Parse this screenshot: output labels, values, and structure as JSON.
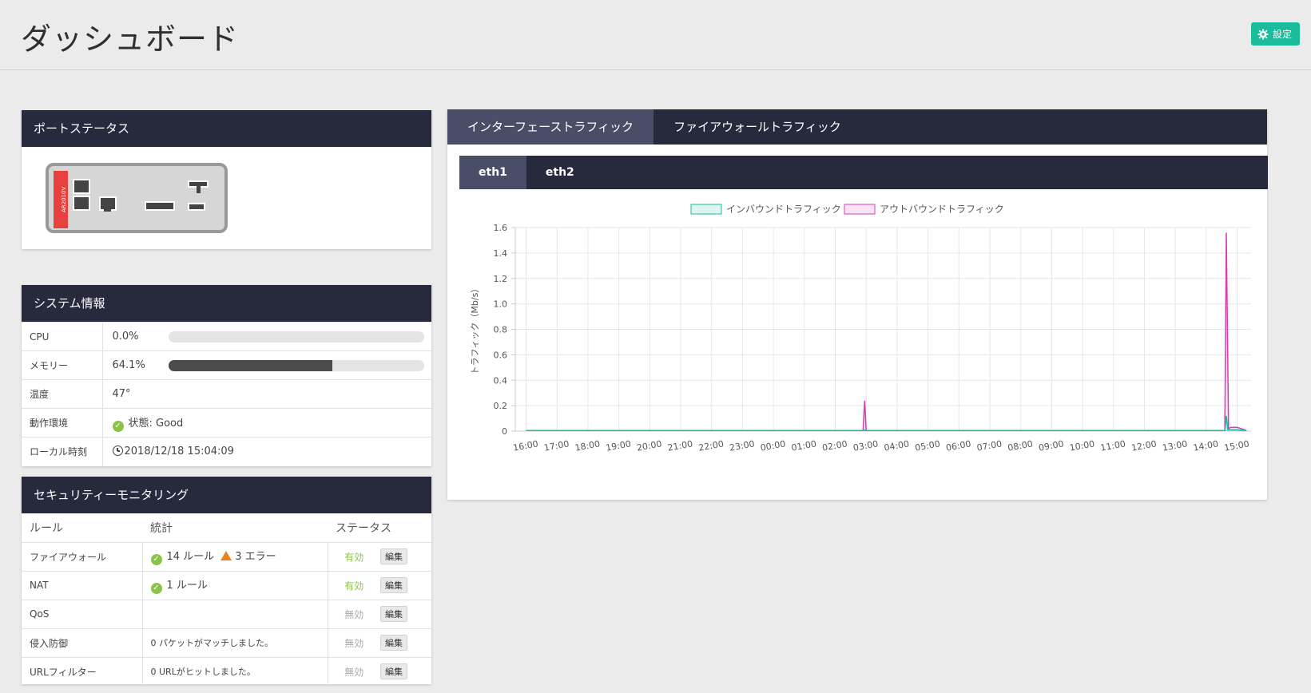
{
  "header": {
    "title": "ダッシュボード",
    "settings_label": "設定"
  },
  "port_status": {
    "title": "ポートステータス",
    "model": "AR2010V"
  },
  "system_info": {
    "title": "システム情報",
    "rows": [
      {
        "label": "CPU",
        "value": "0.0%",
        "fraction": 0.0
      },
      {
        "label": "メモリー",
        "value": "64.1%",
        "fraction": 0.641
      },
      {
        "label": "温度",
        "value": "47°"
      },
      {
        "label": "動作環境",
        "value": "状態: Good"
      },
      {
        "label": "ローカル時刻",
        "value": "2018/12/18 15:04:09"
      }
    ]
  },
  "security": {
    "title": "セキュリティーモニタリング",
    "columns": [
      "ルール",
      "統計",
      "ステータス"
    ],
    "edit_label": "編集",
    "rows": [
      {
        "rule": "ファイアウォール",
        "stat": "14 ルール",
        "errors": "3 エラー",
        "status": "有効"
      },
      {
        "rule": "NAT",
        "stat": "1 ルール",
        "status": "有効"
      },
      {
        "rule": "QoS",
        "stat": "",
        "status": "無効"
      },
      {
        "rule": "侵入防御",
        "stat": "0 パケットがマッチしました。",
        "status": "無効"
      },
      {
        "rule": "URLフィルター",
        "stat": "0 URLがヒットしました。",
        "status": "無効"
      }
    ]
  },
  "traffic": {
    "tabs": [
      "インターフェーストラフィック",
      "ファイアウォールトラフィック"
    ],
    "subtabs": [
      "eth1",
      "eth2"
    ]
  },
  "colors": {
    "inbound": "#1abc9c",
    "outbound": "#d63fb3",
    "header": "#272a3d",
    "accent": "#1abc9c"
  },
  "chart_data": {
    "type": "line",
    "ylabel": "トラフィック（Mb/s）",
    "ylim": [
      0,
      1.6
    ],
    "yticks": [
      "0",
      "0.2",
      "0.4",
      "0.6",
      "0.8",
      "1.0",
      "1.2",
      "1.4",
      "1.6"
    ],
    "x": [
      "16:00",
      "17:00",
      "18:00",
      "19:00",
      "20:00",
      "21:00",
      "22:00",
      "23:00",
      "00:00",
      "01:00",
      "02:00",
      "03:00",
      "04:00",
      "05:00",
      "06:00",
      "07:00",
      "08:00",
      "09:00",
      "10:00",
      "11:00",
      "12:00",
      "13:00",
      "14:00",
      "15:00"
    ],
    "legend": "top",
    "series": [
      {
        "name": "インバウンドトラフィック",
        "points": [
          [
            0,
            0.005
          ],
          [
            10.9,
            0.005
          ],
          [
            10.95,
            0.01
          ],
          [
            11,
            0.005
          ],
          [
            22.6,
            0.005
          ],
          [
            22.65,
            0.12
          ],
          [
            22.7,
            0.01
          ],
          [
            23,
            0.01
          ],
          [
            23.3,
            0.005
          ]
        ]
      },
      {
        "name": "アウトバウンドトラフィック",
        "points": [
          [
            0,
            0.005
          ],
          [
            10.9,
            0.005
          ],
          [
            10.95,
            0.24
          ],
          [
            11,
            0.005
          ],
          [
            22.6,
            0.005
          ],
          [
            22.65,
            1.56
          ],
          [
            22.72,
            0.02
          ],
          [
            22.8,
            0.03
          ],
          [
            23,
            0.03
          ],
          [
            23.3,
            0.005
          ]
        ]
      }
    ]
  }
}
